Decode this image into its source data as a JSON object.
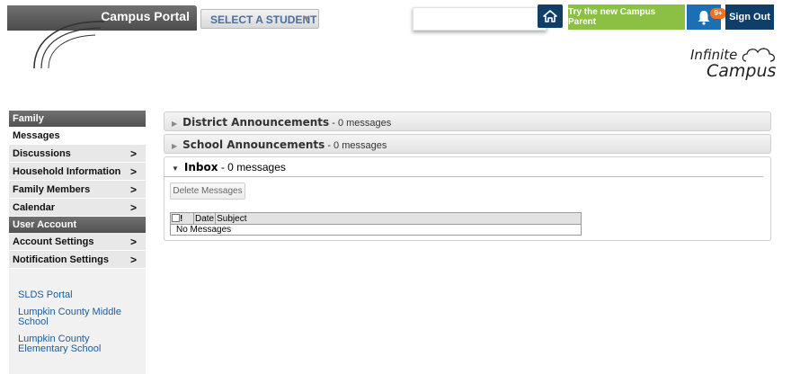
{
  "header": {
    "portal_title": "Campus Portal",
    "student_select": "SELECT A STUDENT",
    "try_new": "Try the new Campus Parent",
    "notifications_badge": "9+",
    "sign_out": "Sign Out",
    "logo_line1": "Infinite",
    "logo_line2": "Campus"
  },
  "sidebar": {
    "family_header": "Family",
    "family_items": [
      {
        "label": "Messages",
        "arrow": ""
      },
      {
        "label": "Discussions",
        "arrow": ">"
      },
      {
        "label": "Household Information",
        "arrow": ">"
      },
      {
        "label": "Family Members",
        "arrow": ">"
      },
      {
        "label": "Calendar",
        "arrow": ">"
      }
    ],
    "account_header": "User Account",
    "account_items": [
      {
        "label": "Account Settings",
        "arrow": ">"
      },
      {
        "label": "Notification Settings",
        "arrow": ">"
      }
    ],
    "links": [
      "SLDS Portal",
      "Lumpkin County Middle School",
      "Lumpkin County Elementary School"
    ]
  },
  "main": {
    "district": {
      "title": "District Announcements",
      "count": " - 0 messages"
    },
    "school": {
      "title": "School Announcements",
      "count": " - 0 messages"
    },
    "inbox": {
      "title": "Inbox",
      "count": " - 0 messages"
    },
    "delete_button": "Delete Messages",
    "table": {
      "columns": [
        "!",
        "Date",
        "Subject"
      ],
      "empty_text": "No Messages"
    }
  },
  "colors": {
    "sidebar_header": "#5e5e5e",
    "try_button": "#8bc045",
    "notification_button": "#1d6fb3",
    "signout_button": "#0f3f68",
    "badge": "#f36f21",
    "link": "#1f5c99"
  }
}
